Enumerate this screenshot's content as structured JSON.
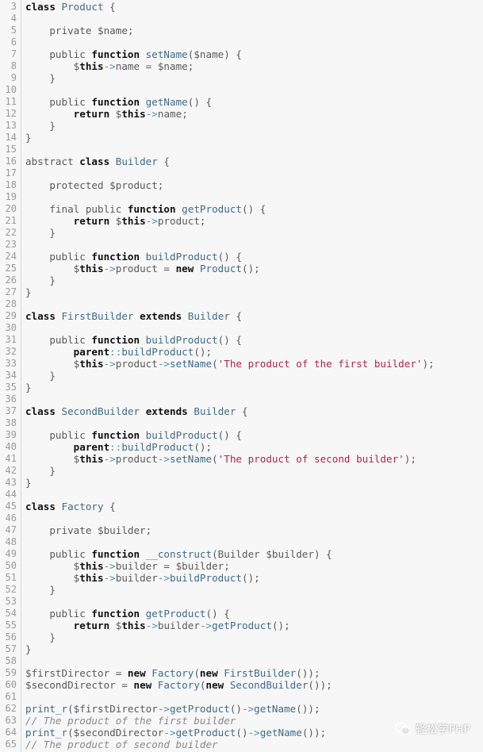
{
  "editor": {
    "lines": [
      {
        "n": "3",
        "t": [
          [
            "k",
            "class"
          ],
          [
            "p",
            " "
          ],
          [
            "f",
            "Product"
          ],
          [
            "p",
            " {"
          ]
        ]
      },
      {
        "n": "4",
        "t": []
      },
      {
        "n": "5",
        "t": [
          [
            "p",
            "    private $name;"
          ]
        ]
      },
      {
        "n": "6",
        "t": []
      },
      {
        "n": "7",
        "t": [
          [
            "p",
            "    public "
          ],
          [
            "k",
            "function"
          ],
          [
            "p",
            " "
          ],
          [
            "f",
            "setName"
          ],
          [
            "p",
            "($name) {"
          ]
        ]
      },
      {
        "n": "8",
        "t": [
          [
            "p",
            "        $"
          ],
          [
            "k",
            "this"
          ],
          [
            "o",
            "->"
          ],
          [
            "p",
            "name = $name;"
          ]
        ]
      },
      {
        "n": "9",
        "t": [
          [
            "p",
            "    }"
          ]
        ]
      },
      {
        "n": "10",
        "t": []
      },
      {
        "n": "11",
        "t": [
          [
            "p",
            "    public "
          ],
          [
            "k",
            "function"
          ],
          [
            "p",
            " "
          ],
          [
            "f",
            "getName"
          ],
          [
            "p",
            "() {"
          ]
        ]
      },
      {
        "n": "12",
        "t": [
          [
            "p",
            "        "
          ],
          [
            "k",
            "return"
          ],
          [
            "p",
            " $"
          ],
          [
            "k",
            "this"
          ],
          [
            "o",
            "->"
          ],
          [
            "p",
            "name;"
          ]
        ]
      },
      {
        "n": "13",
        "t": [
          [
            "p",
            "    }"
          ]
        ]
      },
      {
        "n": "14",
        "t": [
          [
            "p",
            "}"
          ]
        ]
      },
      {
        "n": "15",
        "t": []
      },
      {
        "n": "16",
        "t": [
          [
            "p",
            "abstract "
          ],
          [
            "k",
            "class"
          ],
          [
            "p",
            " "
          ],
          [
            "f",
            "Builder"
          ],
          [
            "p",
            " {"
          ]
        ]
      },
      {
        "n": "17",
        "t": []
      },
      {
        "n": "18",
        "t": [
          [
            "p",
            "    protected $product;"
          ]
        ]
      },
      {
        "n": "19",
        "t": []
      },
      {
        "n": "20",
        "t": [
          [
            "p",
            "    final public "
          ],
          [
            "k",
            "function"
          ],
          [
            "p",
            " "
          ],
          [
            "f",
            "getProduct"
          ],
          [
            "p",
            "() {"
          ]
        ]
      },
      {
        "n": "21",
        "t": [
          [
            "p",
            "        "
          ],
          [
            "k",
            "return"
          ],
          [
            "p",
            " $"
          ],
          [
            "k",
            "this"
          ],
          [
            "o",
            "->"
          ],
          [
            "p",
            "product;"
          ]
        ]
      },
      {
        "n": "22",
        "t": [
          [
            "p",
            "    }"
          ]
        ]
      },
      {
        "n": "23",
        "t": []
      },
      {
        "n": "24",
        "t": [
          [
            "p",
            "    public "
          ],
          [
            "k",
            "function"
          ],
          [
            "p",
            " "
          ],
          [
            "f",
            "buildProduct"
          ],
          [
            "p",
            "() {"
          ]
        ]
      },
      {
        "n": "25",
        "t": [
          [
            "p",
            "        $"
          ],
          [
            "k",
            "this"
          ],
          [
            "o",
            "->"
          ],
          [
            "p",
            "product = "
          ],
          [
            "k",
            "new"
          ],
          [
            "p",
            " "
          ],
          [
            "f",
            "Product"
          ],
          [
            "p",
            "();"
          ]
        ]
      },
      {
        "n": "26",
        "t": [
          [
            "p",
            "    }"
          ]
        ]
      },
      {
        "n": "27",
        "t": [
          [
            "p",
            "}"
          ]
        ]
      },
      {
        "n": "28",
        "t": []
      },
      {
        "n": "29",
        "t": [
          [
            "k",
            "class"
          ],
          [
            "p",
            " "
          ],
          [
            "f",
            "FirstBuilder"
          ],
          [
            "p",
            " "
          ],
          [
            "k",
            "extends"
          ],
          [
            "p",
            " "
          ],
          [
            "f",
            "Builder"
          ],
          [
            "p",
            " {"
          ]
        ]
      },
      {
        "n": "30",
        "t": []
      },
      {
        "n": "31",
        "t": [
          [
            "p",
            "    public "
          ],
          [
            "k",
            "function"
          ],
          [
            "p",
            " "
          ],
          [
            "f",
            "buildProduct"
          ],
          [
            "p",
            "() {"
          ]
        ]
      },
      {
        "n": "32",
        "t": [
          [
            "p",
            "        "
          ],
          [
            "k",
            "parent"
          ],
          [
            "o",
            "::"
          ],
          [
            "f",
            "buildProduct"
          ],
          [
            "p",
            "();"
          ]
        ]
      },
      {
        "n": "33",
        "t": [
          [
            "p",
            "        $"
          ],
          [
            "k",
            "this"
          ],
          [
            "o",
            "->"
          ],
          [
            "p",
            "product"
          ],
          [
            "o",
            "->"
          ],
          [
            "f",
            "setName"
          ],
          [
            "p",
            "("
          ],
          [
            "s",
            "'The product of the first builder'"
          ],
          [
            "p",
            ");"
          ]
        ]
      },
      {
        "n": "34",
        "t": [
          [
            "p",
            "    }"
          ]
        ]
      },
      {
        "n": "35",
        "t": [
          [
            "p",
            "}"
          ]
        ]
      },
      {
        "n": "36",
        "t": []
      },
      {
        "n": "37",
        "t": [
          [
            "k",
            "class"
          ],
          [
            "p",
            " "
          ],
          [
            "f",
            "SecondBuilder"
          ],
          [
            "p",
            " "
          ],
          [
            "k",
            "extends"
          ],
          [
            "p",
            " "
          ],
          [
            "f",
            "Builder"
          ],
          [
            "p",
            " {"
          ]
        ]
      },
      {
        "n": "38",
        "t": []
      },
      {
        "n": "39",
        "t": [
          [
            "p",
            "    public "
          ],
          [
            "k",
            "function"
          ],
          [
            "p",
            " "
          ],
          [
            "f",
            "buildProduct"
          ],
          [
            "p",
            "() {"
          ]
        ]
      },
      {
        "n": "40",
        "t": [
          [
            "p",
            "        "
          ],
          [
            "k",
            "parent"
          ],
          [
            "o",
            "::"
          ],
          [
            "f",
            "buildProduct"
          ],
          [
            "p",
            "();"
          ]
        ]
      },
      {
        "n": "41",
        "t": [
          [
            "p",
            "        $"
          ],
          [
            "k",
            "this"
          ],
          [
            "o",
            "->"
          ],
          [
            "p",
            "product"
          ],
          [
            "o",
            "->"
          ],
          [
            "f",
            "setName"
          ],
          [
            "p",
            "("
          ],
          [
            "s",
            "'The product of second builder'"
          ],
          [
            "p",
            ");"
          ]
        ]
      },
      {
        "n": "42",
        "t": [
          [
            "p",
            "    }"
          ]
        ]
      },
      {
        "n": "43",
        "t": [
          [
            "p",
            "}"
          ]
        ]
      },
      {
        "n": "44",
        "t": []
      },
      {
        "n": "45",
        "t": [
          [
            "k",
            "class"
          ],
          [
            "p",
            " "
          ],
          [
            "f",
            "Factory"
          ],
          [
            "p",
            " {"
          ]
        ]
      },
      {
        "n": "46",
        "t": []
      },
      {
        "n": "47",
        "t": [
          [
            "p",
            "    private $builder;"
          ]
        ]
      },
      {
        "n": "48",
        "t": []
      },
      {
        "n": "49",
        "t": [
          [
            "p",
            "    public "
          ],
          [
            "k",
            "function"
          ],
          [
            "p",
            " "
          ],
          [
            "f",
            "__construct"
          ],
          [
            "p",
            "(Builder $builder) {"
          ]
        ]
      },
      {
        "n": "50",
        "t": [
          [
            "p",
            "        $"
          ],
          [
            "k",
            "this"
          ],
          [
            "o",
            "->"
          ],
          [
            "p",
            "builder = $builder;"
          ]
        ]
      },
      {
        "n": "51",
        "t": [
          [
            "p",
            "        $"
          ],
          [
            "k",
            "this"
          ],
          [
            "o",
            "->"
          ],
          [
            "p",
            "builder"
          ],
          [
            "o",
            "->"
          ],
          [
            "f",
            "buildProduct"
          ],
          [
            "p",
            "();"
          ]
        ]
      },
      {
        "n": "52",
        "t": [
          [
            "p",
            "    }"
          ]
        ]
      },
      {
        "n": "53",
        "t": []
      },
      {
        "n": "54",
        "t": [
          [
            "p",
            "    public "
          ],
          [
            "k",
            "function"
          ],
          [
            "p",
            " "
          ],
          [
            "f",
            "getProduct"
          ],
          [
            "p",
            "() {"
          ]
        ]
      },
      {
        "n": "55",
        "t": [
          [
            "p",
            "        "
          ],
          [
            "k",
            "return"
          ],
          [
            "p",
            " $"
          ],
          [
            "k",
            "this"
          ],
          [
            "o",
            "->"
          ],
          [
            "p",
            "builder"
          ],
          [
            "o",
            "->"
          ],
          [
            "f",
            "getProduct"
          ],
          [
            "p",
            "();"
          ]
        ]
      },
      {
        "n": "56",
        "t": [
          [
            "p",
            "    }"
          ]
        ]
      },
      {
        "n": "57",
        "t": [
          [
            "p",
            "}"
          ]
        ]
      },
      {
        "n": "58",
        "t": []
      },
      {
        "n": "59",
        "t": [
          [
            "p",
            "$firstDirector = "
          ],
          [
            "k",
            "new"
          ],
          [
            "p",
            " "
          ],
          [
            "f",
            "Factory"
          ],
          [
            "p",
            "("
          ],
          [
            "k",
            "new"
          ],
          [
            "p",
            " "
          ],
          [
            "f",
            "FirstBuilder"
          ],
          [
            "p",
            "());"
          ]
        ]
      },
      {
        "n": "60",
        "t": [
          [
            "p",
            "$secondDirector = "
          ],
          [
            "k",
            "new"
          ],
          [
            "p",
            " "
          ],
          [
            "f",
            "Factory"
          ],
          [
            "p",
            "("
          ],
          [
            "k",
            "new"
          ],
          [
            "p",
            " "
          ],
          [
            "f",
            "SecondBuilder"
          ],
          [
            "p",
            "());"
          ]
        ]
      },
      {
        "n": "61",
        "t": []
      },
      {
        "n": "62",
        "t": [
          [
            "f",
            "print_r"
          ],
          [
            "p",
            "($firstDirector"
          ],
          [
            "o",
            "->"
          ],
          [
            "f",
            "getProduct"
          ],
          [
            "p",
            "()"
          ],
          [
            "o",
            "->"
          ],
          [
            "f",
            "getName"
          ],
          [
            "p",
            "());"
          ]
        ]
      },
      {
        "n": "63",
        "t": [
          [
            "c",
            "// The product of the first builder"
          ]
        ]
      },
      {
        "n": "64",
        "t": [
          [
            "f",
            "print_r"
          ],
          [
            "p",
            "($secondDirector"
          ],
          [
            "o",
            "->"
          ],
          [
            "f",
            "getProduct"
          ],
          [
            "p",
            "()"
          ],
          [
            "o",
            "->"
          ],
          [
            "f",
            "getName"
          ],
          [
            "p",
            "());"
          ]
        ]
      },
      {
        "n": "65",
        "t": [
          [
            "c",
            "// The product of second builder"
          ]
        ]
      }
    ]
  },
  "watermark": {
    "icon": "wechat-icon",
    "text": "轻松学PHP"
  }
}
